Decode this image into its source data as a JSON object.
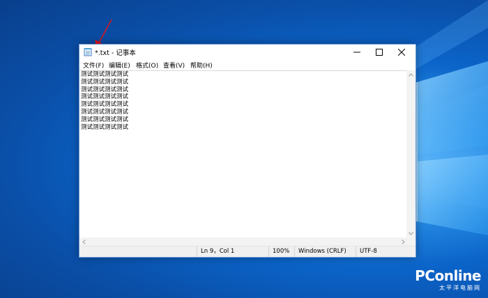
{
  "window": {
    "title": "*.txt - 记事本",
    "controls": {
      "minimize_icon": "minimize-icon",
      "maximize_icon": "maximize-icon",
      "close_icon": "close-icon"
    }
  },
  "menu": [
    "文件(F)",
    "编辑(E)",
    "格式(O)",
    "查看(V)",
    "帮助(H)"
  ],
  "editor": {
    "lines": [
      "测试测试测试测试",
      "测试测试测试测试",
      "测试测试测试测试",
      "测试测试测试测试",
      "测试测试测试测试",
      "测试测试测试测试",
      "测试测试测试测试",
      "测试测试测试测试"
    ]
  },
  "status": {
    "position": "Ln 9，Col 1",
    "zoom": "100%",
    "line_ending": "Windows (CRLF)",
    "encoding": "UTF-8"
  },
  "watermark": {
    "brand": "PConline",
    "subtitle": "太平洋电脑网"
  },
  "colors": {
    "desktop": "#0a57b8",
    "annotation_arrow": "#e0141b",
    "window_border": "#6b9ad6"
  }
}
